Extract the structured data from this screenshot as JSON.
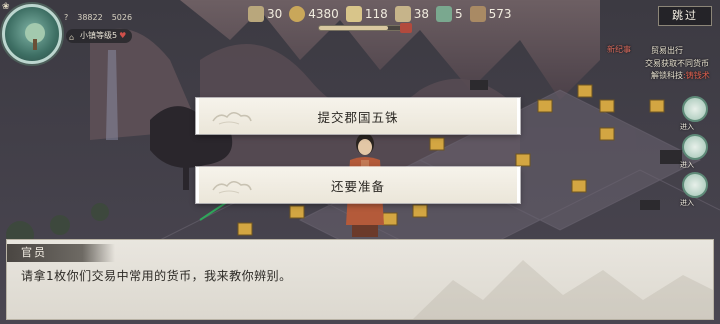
{
  "hud": {
    "mini_stats": [
      "?",
      "38822",
      "5026"
    ],
    "town_label": "小镇等级5",
    "resources": [
      {
        "icon": "population-icon",
        "value": "30",
        "color": "#b9a77c"
      },
      {
        "icon": "coin-icon",
        "value": "4380",
        "color": "#c9a75a"
      },
      {
        "icon": "grain-icon",
        "value": "118",
        "color": "#d8c58a"
      },
      {
        "icon": "scroll-icon",
        "value": "38",
        "color": "#c6b48a"
      },
      {
        "icon": "tool-icon",
        "value": "5",
        "color": "#7aa88f"
      },
      {
        "icon": "wood-icon",
        "value": "573",
        "color": "#a98a64"
      }
    ],
    "progress": {
      "fraction": 0.75,
      "badge": ""
    },
    "skip_label": "跳过"
  },
  "side": {
    "new_era": "新纪事",
    "trade_out": "贸易出行",
    "currency": "交易获取不同货币",
    "unlock_prefix": "解锁科技",
    "unlock_highlight": ":铸钱术",
    "buttons": [
      "进入",
      "进入",
      "进入"
    ]
  },
  "choices": [
    {
      "label": "提交郡国五铢"
    },
    {
      "label": "还要准备"
    }
  ],
  "dialog": {
    "speaker": "官员",
    "text": "请拿1枚你们交易中常用的货币，我来教你辨别。"
  },
  "colors": {
    "accent_red": "#d0504a",
    "panel": "#e9e6df",
    "button": "#f4f1e8"
  }
}
